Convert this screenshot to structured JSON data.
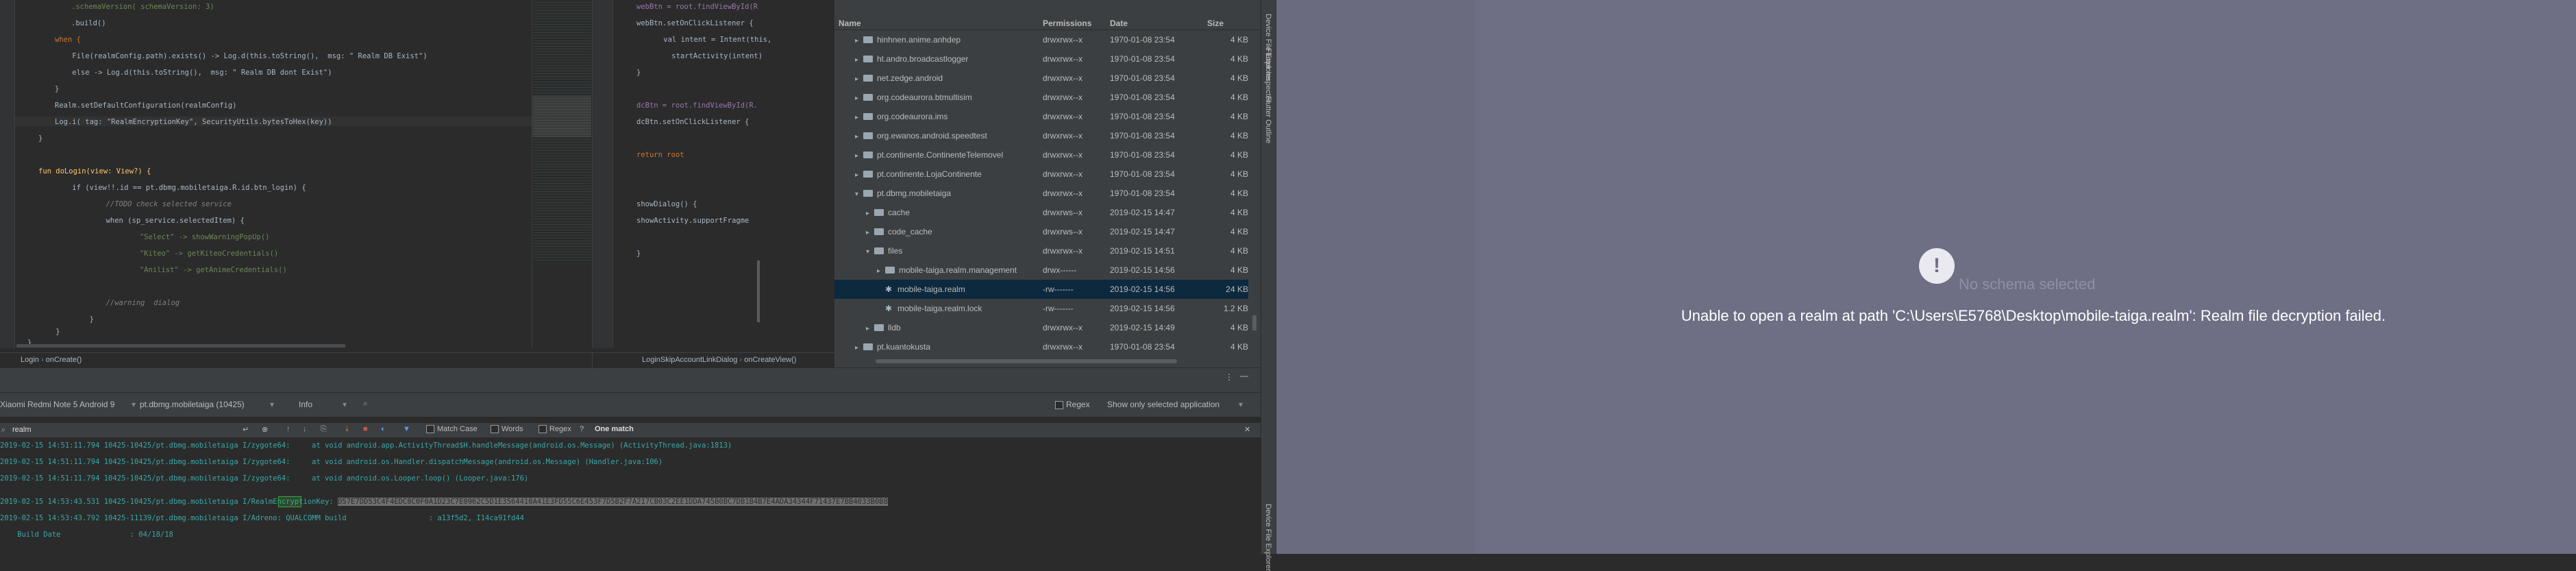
{
  "editor_left": {
    "lines": [
      ".schemaVersion( schemaVersion: 3)",
      ".build()",
      "when {",
      "    File(realmConfig.path).exists() -> Log.d(this.toString(),  msg: \" Realm DB Exist\")",
      "    else -> Log.d(this.toString(),  msg: \" Realm DB dont Exist\")",
      "}",
      "Realm.setDefaultConfiguration(realmConfig)",
      "Log.i( tag: \"RealmEncryptionKey\", SecurityUtils.bytesToHex(key))",
      "}",
      "",
      "fun doLogin(view: View?) {",
      "    if (view!!.id == pt.dbmg.mobiletaiga.R.id.btn_login) {",
      "        //TODO check selected service",
      "        when (sp_service.selectedItem) {",
      "            \"Select\" -> showWarningPopUp()",
      "            \"Kiteo\" -> getKiteoCredentials()",
      "            \"Anilist\" -> getAnimeCredentials()",
      "",
      "",
      "        //warning  dialog",
      "        }",
      "    }",
      "}"
    ],
    "breadcrumb": [
      "Login",
      "onCreate()"
    ]
  },
  "editor_right": {
    "lines": [
      "webBtn = root.findViewById(R",
      "webBtn.setOnClickListener {",
      "    val intent = Intent(this,",
      "    startActivity(intent)",
      "}",
      "",
      "",
      "dcBtn = root.findViewById(R.",
      "dcBtn.setOnClickListener {",
      "",
      "",
      "return root",
      "",
      "",
      "showDialog() {",
      "showActivity.supportFragme",
      "",
      "}"
    ],
    "breadcrumb": [
      "LoginSkipAccountLinkDialog",
      "onCreateView()"
    ]
  },
  "file_explorer": {
    "columns": [
      "Name",
      "Permissions",
      "Date",
      "Size"
    ],
    "rows": [
      {
        "name": "hinhnen.anime.anhdep",
        "perm": "drwxrwx--x",
        "date": "1970-01-08 23:54",
        "size": "4 KB",
        "kind": "folder",
        "depth": 1,
        "expanded": false
      },
      {
        "name": "ht.andro.broadcastlogger",
        "perm": "drwxrwx--x",
        "date": "1970-01-08 23:54",
        "size": "4 KB",
        "kind": "folder",
        "depth": 1,
        "expanded": false
      },
      {
        "name": "net.zedge.android",
        "perm": "drwxrwx--x",
        "date": "1970-01-08 23:54",
        "size": "4 KB",
        "kind": "folder",
        "depth": 1,
        "expanded": false
      },
      {
        "name": "org.codeaurora.btmultisim",
        "perm": "drwxrwx--x",
        "date": "1970-01-08 23:54",
        "size": "4 KB",
        "kind": "folder",
        "depth": 1,
        "expanded": false
      },
      {
        "name": "org.codeaurora.ims",
        "perm": "drwxrwx--x",
        "date": "1970-01-08 23:54",
        "size": "4 KB",
        "kind": "folder",
        "depth": 1,
        "expanded": false
      },
      {
        "name": "org.ewanos.android.speedtest",
        "perm": "drwxrwx--x",
        "date": "1970-01-08 23:54",
        "size": "4 KB",
        "kind": "folder",
        "depth": 1,
        "expanded": false
      },
      {
        "name": "pt.continente.ContinenteTelemovel",
        "perm": "drwxrwx--x",
        "date": "1970-01-08 23:54",
        "size": "4 KB",
        "kind": "folder",
        "depth": 1,
        "expanded": false
      },
      {
        "name": "pt.continente.LojaContinente",
        "perm": "drwxrwx--x",
        "date": "1970-01-08 23:54",
        "size": "4 KB",
        "kind": "folder",
        "depth": 1,
        "expanded": false
      },
      {
        "name": "pt.dbmg.mobiletaiga",
        "perm": "drwxrwx--x",
        "date": "1970-01-08 23:54",
        "size": "4 KB",
        "kind": "folder",
        "depth": 1,
        "expanded": true
      },
      {
        "name": "cache",
        "perm": "drwxrws--x",
        "date": "2019-02-15 14:47",
        "size": "4 KB",
        "kind": "folder",
        "depth": 2,
        "expanded": false
      },
      {
        "name": "code_cache",
        "perm": "drwxrws--x",
        "date": "2019-02-15 14:47",
        "size": "4 KB",
        "kind": "folder",
        "depth": 2,
        "expanded": false
      },
      {
        "name": "files",
        "perm": "drwxrwx--x",
        "date": "2019-02-15 14:51",
        "size": "4 KB",
        "kind": "folder",
        "depth": 2,
        "expanded": true
      },
      {
        "name": "mobile-taiga.realm.management",
        "perm": "drwx------",
        "date": "2019-02-15 14:56",
        "size": "4 KB",
        "kind": "folder",
        "depth": 3,
        "expanded": false
      },
      {
        "name": "mobile-taiga.realm",
        "perm": "-rw-------",
        "date": "2019-02-15 14:56",
        "size": "24 KB",
        "kind": "file",
        "depth": 3,
        "expanded": false,
        "selected": true
      },
      {
        "name": "mobile-taiga.realm.lock",
        "perm": "-rw-------",
        "date": "2019-02-15 14:56",
        "size": "1.2 KB",
        "kind": "file",
        "depth": 3,
        "expanded": false
      },
      {
        "name": "lldb",
        "perm": "drwxrwx--x",
        "date": "2019-02-15 14:49",
        "size": "4 KB",
        "kind": "folder",
        "depth": 2,
        "expanded": false
      },
      {
        "name": "pt.kuantokusta",
        "perm": "drwxrwx--x",
        "date": "1970-01-08 23:54",
        "size": "4 KB",
        "kind": "folder",
        "depth": 1,
        "expanded": false
      }
    ]
  },
  "side_tabs": {
    "strip1": [
      "Device File Explorer",
      "Flutter Inspector",
      "Flutter Outline"
    ],
    "strip2": [
      "Device File Explorer"
    ]
  },
  "logcat": {
    "device": "Xiaomi Redmi Note 5 Android 9",
    "package": "pt.dbmg.mobiletaiga (10425)",
    "level": "Info",
    "regex_label": "Regex",
    "filter_select": "Show only selected application",
    "search_value": "realm",
    "match_case": "Match Case",
    "words": "Words",
    "regex2": "Regex",
    "help": "?",
    "match_count": "One match",
    "lines": [
      "2019-02-15 14:51:11.794 10425-10425/pt.dbmg.mobiletaiga I/zygote64:     at void android.app.ActivityThread$H.handleMessage(android.os.Message) (ActivityThread.java:1813)",
      "2019-02-15 14:51:11.794 10425-10425/pt.dbmg.mobiletaiga I/zygote64:     at void android.os.Handler.dispatchMessage(android.os.Message) (Handler.java:106)",
      "2019-02-15 14:51:11.794 10425-10425/pt.dbmg.mobiletaiga I/zygote64:     at void android.os.Looper.loop() (Looper.java:176)",
      "2019-02-15 14:53:43.531 10425-10425/pt.dbmg.mobiletaiga I/RealmEncryptionKey: ",
      "2019-02-15 14:53:43.792 10425-11139/pt.dbmg.mobiletaiga I/Adreno: QUALCOMM build                   : a13f5d2, I14ca91fd44",
      "    Build Date                : 04/18/18"
    ],
    "realm_key": "",
    "key_hex": "D57E7DD53C4F4EDC8C0F0A1D23C7E0962C5D1E3564410A41E3FD55C6E453F7D5B2F7A217CB03C2EE1DDA745B0BC7DB1B4B7E4ADA34344F71437E7BB4033B0B8"
  },
  "realm": {
    "no_schema": "No schema selected",
    "error": "Unable to open a realm at path 'C:\\Users\\E5768\\Desktop\\mobile-taiga.realm': Realm file decryption failed."
  }
}
